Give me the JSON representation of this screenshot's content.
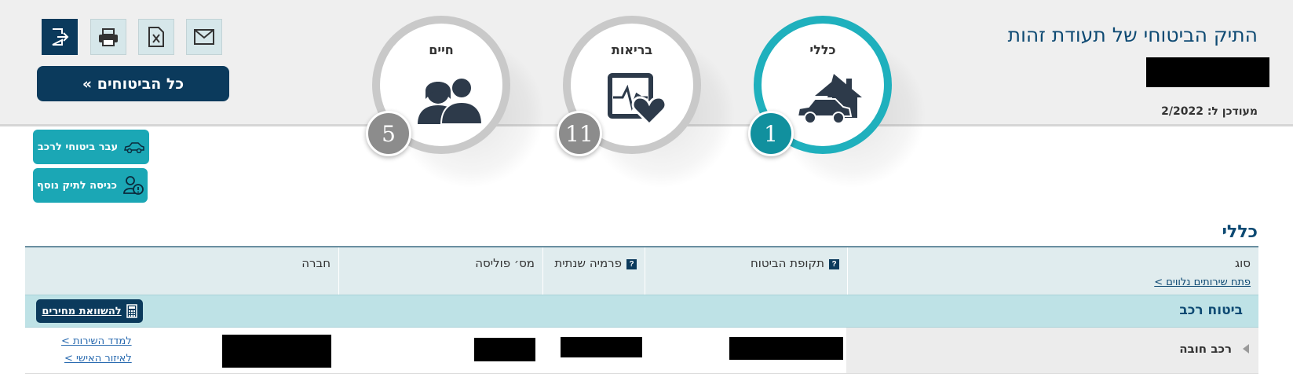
{
  "header": {
    "title": "התיק הביטוחי של תעודת זהות",
    "updated_label": "מעודכן ל: 2/2022"
  },
  "categories": [
    {
      "label": "כללי",
      "count": "1",
      "icon": "house-car-icon",
      "active": true
    },
    {
      "label": "בריאות",
      "count": "11",
      "icon": "heart-monitor-icon",
      "active": false
    },
    {
      "label": "חיים",
      "count": "5",
      "icon": "family-icon",
      "active": false
    }
  ],
  "toolbar": {
    "all_insurances_label": "כל הביטוחים »",
    "icons": [
      "mail-icon",
      "excel-icon",
      "print-icon",
      "exit-icon"
    ]
  },
  "side_actions": {
    "vehicle_label": "עבר ביטוחי לרכב",
    "extra_file_label": "כניסה לתיק נוסף"
  },
  "section": {
    "title": "כללי",
    "columns": {
      "type": "סוג",
      "period": "תקופת הביטוח",
      "premium": "פרמיה שנתית",
      "policy": "מס׳ פוליסה",
      "company": "חברה"
    },
    "open_services_link": "פתח שירותים נלווים >",
    "group": {
      "title": "ביטוח רכב",
      "compare_label": "להשוואת מחירים"
    },
    "rows": [
      {
        "type": "רכב חובה",
        "service_link": "למדד השירות >",
        "personal_link": "לאיזור האישי >"
      }
    ]
  },
  "colors": {
    "navy": "#0b3a5c",
    "teal": "#1ba7b5",
    "title_blue": "#0e4a73"
  }
}
